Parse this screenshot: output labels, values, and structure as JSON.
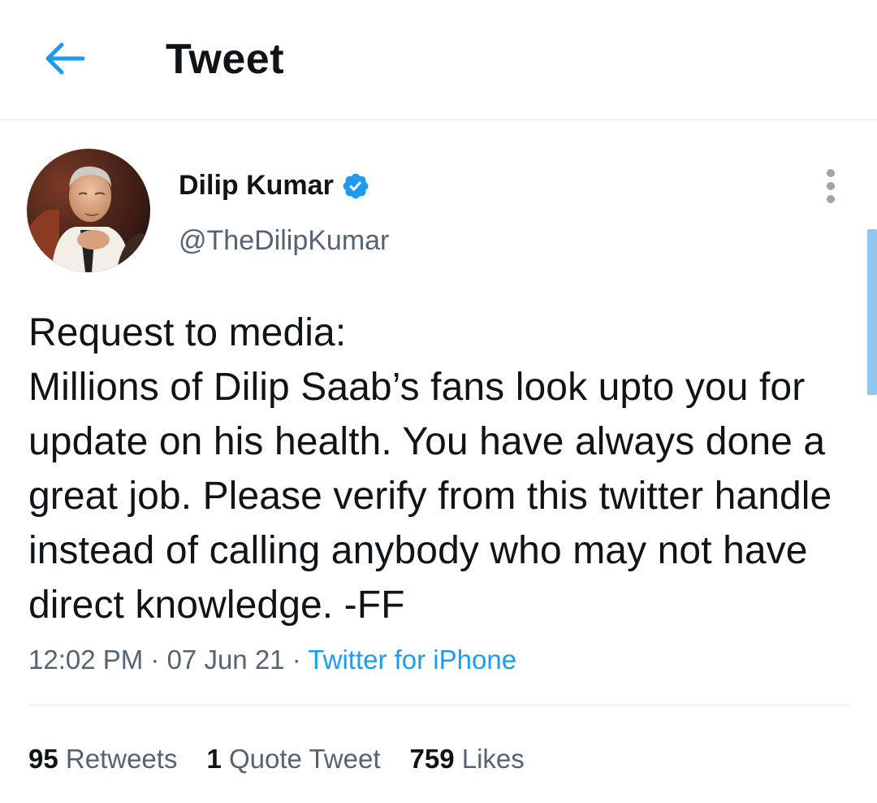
{
  "header": {
    "title": "Tweet",
    "back_icon": "arrow-left-icon"
  },
  "author": {
    "name": "Dilip Kumar",
    "handle": "@TheDilipKumar",
    "verified": true,
    "verified_icon": "verified-badge-icon"
  },
  "tweet": {
    "text": "Request to media:\nMillions of Dilip Saab’s fans look upto you for update on his health. You have always done a great job. Please verify from this twitter handle instead of calling anybody who may not have direct knowledge. -FF",
    "time": "12:02 PM",
    "separator1": " · ",
    "date": "07 Jun 21",
    "separator2": " · ",
    "source": "Twitter for iPhone"
  },
  "stats": {
    "retweets_count": "95",
    "retweets_label": "Retweets",
    "quotes_count": "1",
    "quotes_label": "Quote Tweet",
    "likes_count": "759",
    "likes_label": "Likes"
  },
  "colors": {
    "accent": "#1d9bf0",
    "text_primary": "#0f1419",
    "text_secondary": "#566370",
    "divider": "#e1e6ea"
  }
}
